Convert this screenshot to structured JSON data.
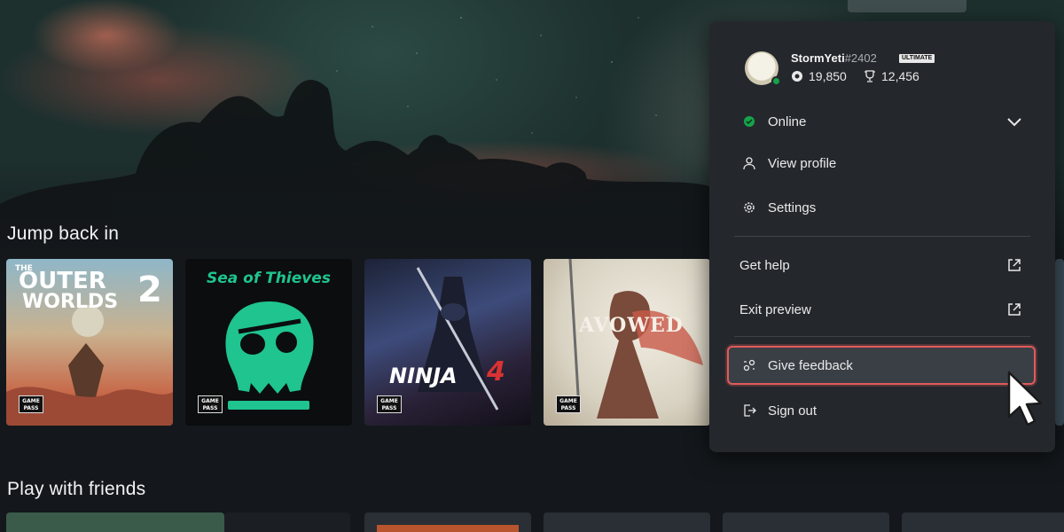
{
  "sections": {
    "jump_back_in": "Jump back in",
    "play_with_friends": "Play with friends"
  },
  "games": [
    {
      "title_line1": "THE",
      "title_line2": "OUTER",
      "title_line3": "WORLDS",
      "title_num": "2",
      "badge": "GAME PASS"
    },
    {
      "title": "Sea of Thieves",
      "badge": "GAME PASS"
    },
    {
      "title": "NINJA",
      "title_num": "4",
      "badge": "GAME PASS"
    },
    {
      "title": "AVOWED",
      "badge": "GAME PASS"
    }
  ],
  "profile": {
    "gamertag": "StormYeti",
    "gamertag_suffix": "#2402",
    "tier_badge": "ULTIMATE",
    "rewards_points": "19,850",
    "gamerscore": "12,456"
  },
  "menu": {
    "status": "Online",
    "view_profile": "View profile",
    "settings": "Settings",
    "get_help": "Get help",
    "exit_preview": "Exit preview",
    "give_feedback": "Give feedback",
    "sign_out": "Sign out"
  },
  "colors": {
    "online_status": "#16a34a",
    "highlight_border": "#e05a5a",
    "menu_background": "#24282d"
  },
  "icons": [
    "status-dot-icon",
    "chevron-down-icon",
    "person-icon",
    "gear-icon",
    "external-link-icon",
    "feedback-icon",
    "sign-out-icon",
    "mouse-cursor-icon",
    "rewards-icon",
    "trophy-icon"
  ]
}
